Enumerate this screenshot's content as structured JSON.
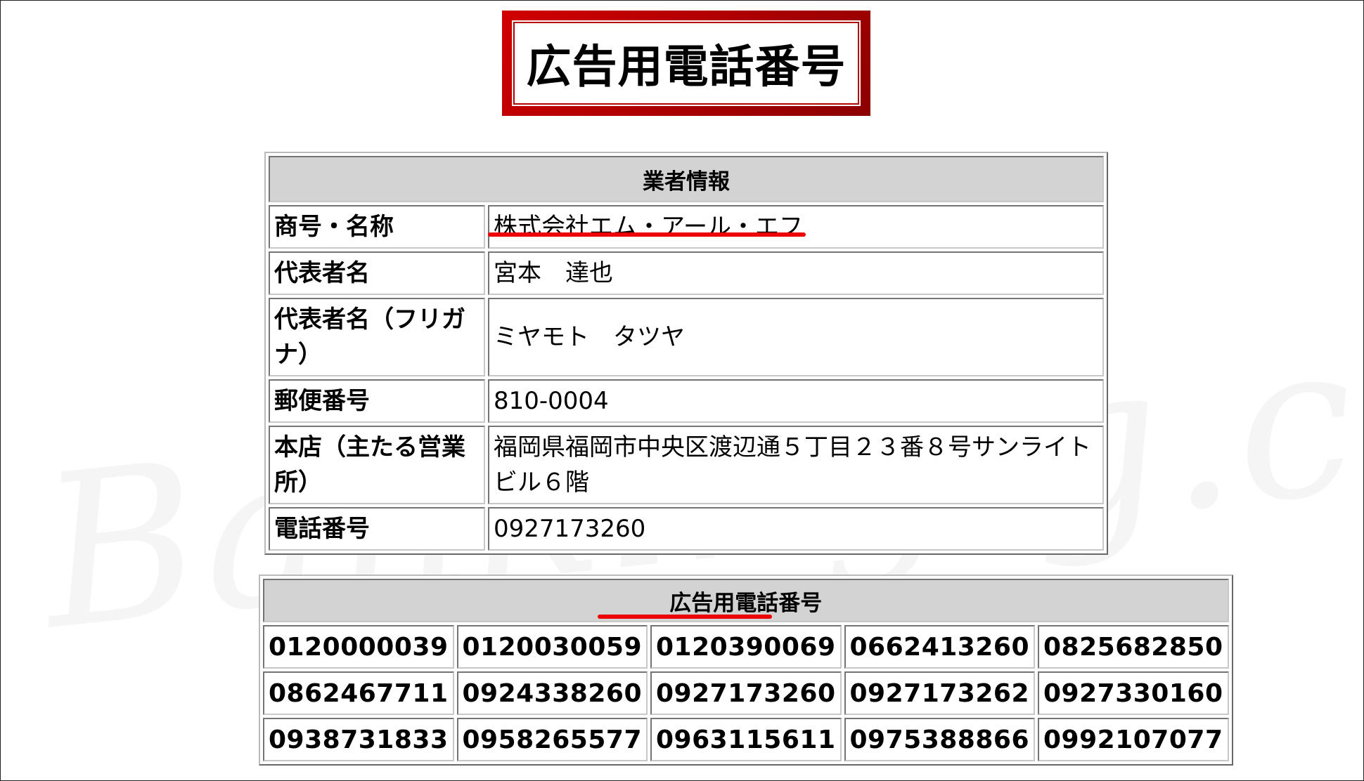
{
  "page": {
    "title": "広告用電話番号",
    "watermark": "Banking-g.com"
  },
  "company_table": {
    "header": "業者情報",
    "rows": [
      {
        "label": "商号・名称",
        "value": "株式会社エム・アール・エフ"
      },
      {
        "label": "代表者名",
        "value": "宮本　達也"
      },
      {
        "label": "代表者名（フリガナ）",
        "value": "ミヤモト　タツヤ"
      },
      {
        "label": "郵便番号",
        "value": "810-0004"
      },
      {
        "label": "本店（主たる営業所）",
        "value": "福岡県福岡市中央区渡辺通５丁目２３番８号サンライトビル６階"
      },
      {
        "label": "電話番号",
        "value": "0927173260"
      }
    ]
  },
  "phone_table": {
    "header": "広告用電話番号",
    "rows": [
      [
        "0120000039",
        "0120030059",
        "0120390069",
        "0662413260",
        "0825682850"
      ],
      [
        "0862467711",
        "0924338260",
        "0927173260",
        "0927173262",
        "0927330160"
      ],
      [
        "0938731833",
        "0958265577",
        "0963115611",
        "0975388866",
        "0992107077"
      ]
    ]
  },
  "colors": {
    "title_border": "#c00000",
    "header_bg": "#d3d3d3",
    "highlight_underline": "#ee0000"
  }
}
